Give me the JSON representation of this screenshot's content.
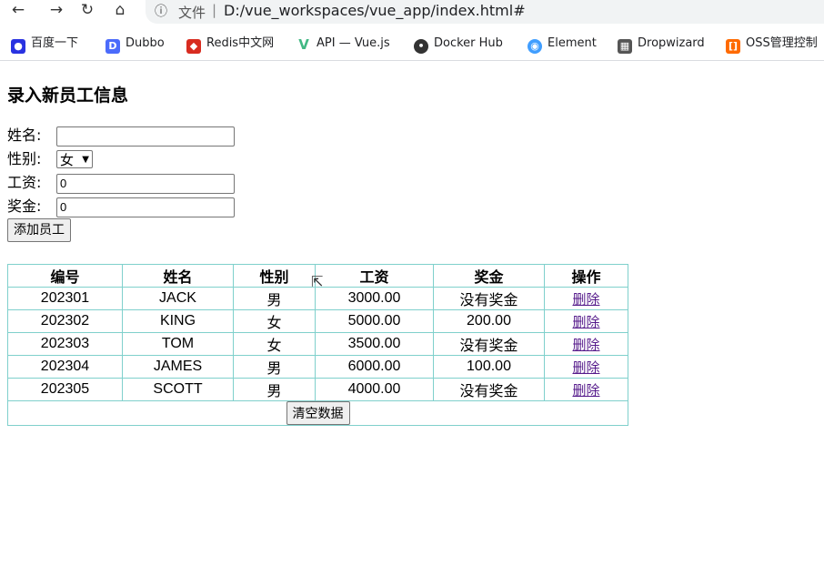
{
  "browser": {
    "url_scheme": "文件",
    "url": "D:/vue_workspaces/vue_app/index.html#",
    "bookmarks": [
      {
        "label": "百度一下",
        "icon": "baidu-icon"
      },
      {
        "label": "Dubbo",
        "icon": "dubbo-icon"
      },
      {
        "label": "Redis中文网",
        "icon": "redis-icon"
      },
      {
        "label": "API — Vue.js",
        "icon": "vue-icon"
      },
      {
        "label": "Docker Hub",
        "icon": "docker-icon"
      },
      {
        "label": "Element",
        "icon": "element-icon"
      },
      {
        "label": "Dropwizard",
        "icon": "dropwizard-icon"
      },
      {
        "label": "OSS管理控制",
        "icon": "oss-icon"
      }
    ]
  },
  "form": {
    "title": "录入新员工信息",
    "name_label": "姓名:",
    "name_value": "",
    "gender_label": "性别:",
    "gender_value": "女",
    "salary_label": "工资:",
    "salary_value": "0",
    "bonus_label": "奖金:",
    "bonus_value": "0",
    "add_button": "添加员工"
  },
  "table": {
    "headers": [
      "编号",
      "姓名",
      "性别",
      "工资",
      "奖金",
      "操作"
    ],
    "rows": [
      {
        "id": "202301",
        "name": "JACK",
        "gender": "男",
        "salary": "3000.00",
        "bonus": "没有奖金",
        "action": "删除"
      },
      {
        "id": "202302",
        "name": "KING",
        "gender": "女",
        "salary": "5000.00",
        "bonus": "200.00",
        "action": "删除"
      },
      {
        "id": "202303",
        "name": "TOM",
        "gender": "女",
        "salary": "3500.00",
        "bonus": "没有奖金",
        "action": "删除"
      },
      {
        "id": "202304",
        "name": "JAMES",
        "gender": "男",
        "salary": "6000.00",
        "bonus": "100.00",
        "action": "删除"
      },
      {
        "id": "202305",
        "name": "SCOTT",
        "gender": "男",
        "salary": "4000.00",
        "bonus": "没有奖金",
        "action": "删除"
      }
    ],
    "clear_button": "清空数据"
  }
}
